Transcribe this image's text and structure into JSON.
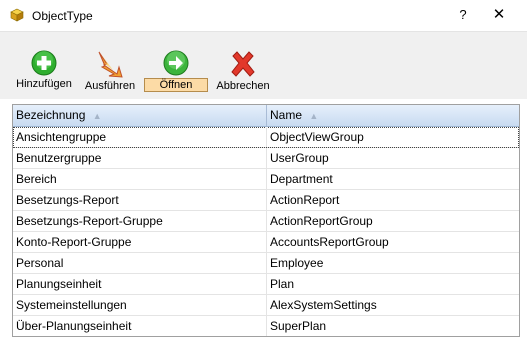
{
  "window": {
    "title": "ObjectType",
    "help_label": "?",
    "close_label": "✕"
  },
  "toolbar": {
    "add_label": "Hinzufügen",
    "run_label": "Ausführen",
    "open_label": "Öffnen",
    "cancel_label": "Abbrechen"
  },
  "grid": {
    "columns": [
      {
        "label": "Bezeichnung",
        "sort": "▲"
      },
      {
        "label": "Name",
        "sort": "▲"
      }
    ],
    "rows": [
      {
        "bezeichnung": "Ansichtengruppe",
        "name": "ObjectViewGroup"
      },
      {
        "bezeichnung": "Benutzergruppe",
        "name": "UserGroup"
      },
      {
        "bezeichnung": "Bereich",
        "name": "Department"
      },
      {
        "bezeichnung": "Besetzungs-Report",
        "name": "ActionReport"
      },
      {
        "bezeichnung": "Besetzungs-Report-Gruppe",
        "name": "ActionReportGroup"
      },
      {
        "bezeichnung": "Konto-Report-Gruppe",
        "name": "AccountsReportGroup"
      },
      {
        "bezeichnung": "Personal",
        "name": "Employee"
      },
      {
        "bezeichnung": "Planungseinheit",
        "name": "Plan"
      },
      {
        "bezeichnung": "Systemeinstellungen",
        "name": "AlexSystemSettings"
      },
      {
        "bezeichnung": "Über-Planungseinheit",
        "name": "SuperPlan"
      }
    ]
  },
  "colors": {
    "header_gradient_top": "#e6f0fb",
    "header_gradient_bottom": "#c8dbf1",
    "add_green": "#2fae2f",
    "open_green": "#3cb43c",
    "cancel_red": "#e2382b",
    "run_orange": "#f0a030",
    "selected_button_bg": "#fcdba6"
  },
  "icons": {
    "app": "yellow-cube-icon",
    "add": "green-plus-icon",
    "run": "lightning-arrow-icon",
    "open": "green-arrow-right-icon",
    "cancel": "red-x-icon"
  }
}
